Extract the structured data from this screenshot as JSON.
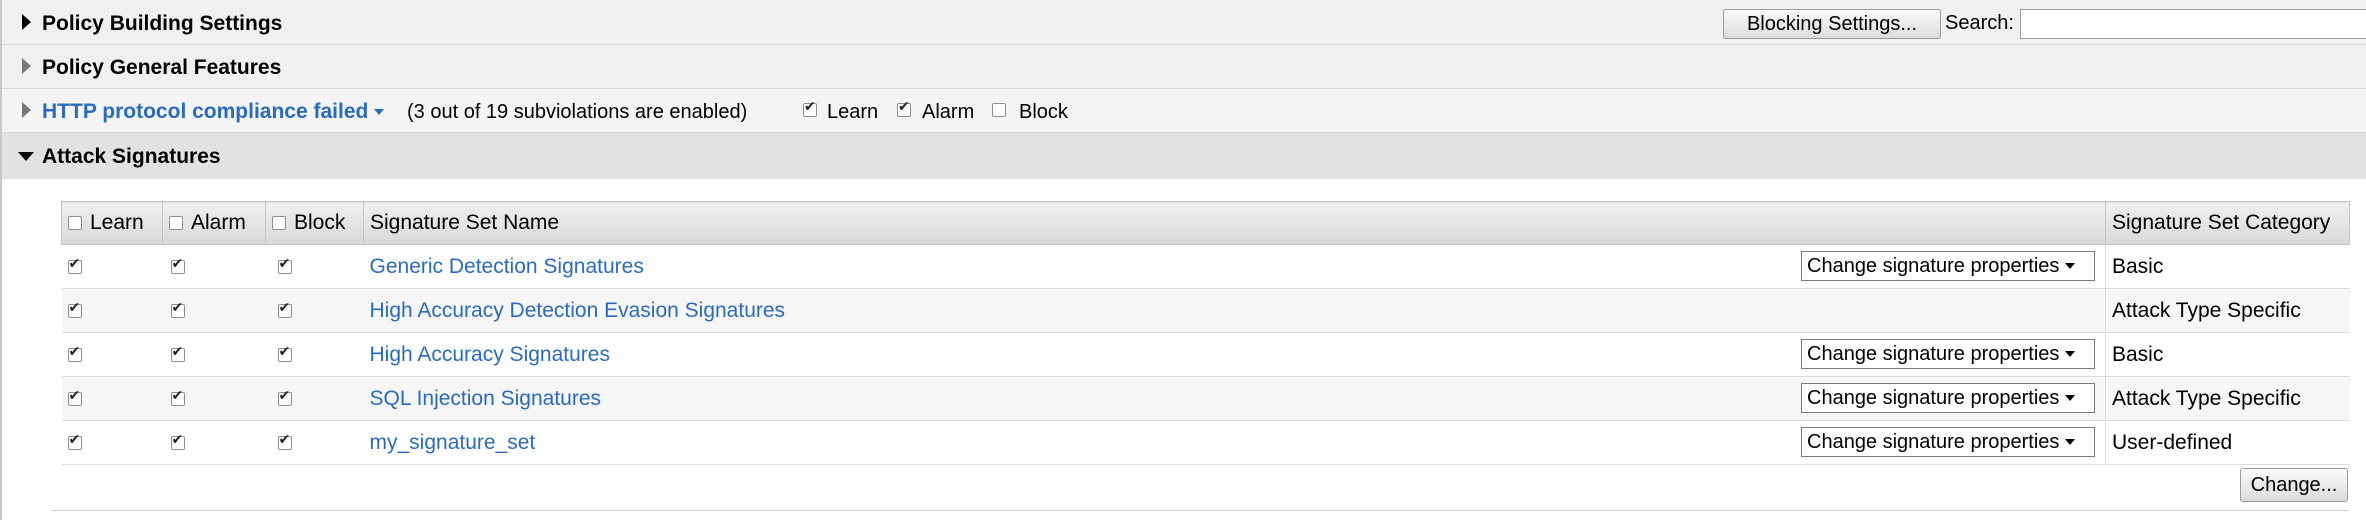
{
  "header": {
    "policy_building_title": "Policy Building Settings",
    "blocking_settings_label": "Blocking Settings...",
    "search_label": "Search:",
    "search_value": "",
    "search_placeholder": ""
  },
  "general_features": {
    "title": "Policy General Features"
  },
  "http_compliance": {
    "link_text": "HTTP protocol compliance failed",
    "summary": "(3 out of 19 subviolations are enabled)",
    "learn_label": "Learn",
    "learn_checked": true,
    "alarm_label": "Alarm",
    "alarm_checked": true,
    "block_label": "Block",
    "block_checked": false
  },
  "attack_signatures": {
    "title": "Attack Signatures",
    "columns": {
      "learn": "Learn",
      "alarm": "Alarm",
      "block": "Block",
      "set_name": "Signature Set Name",
      "category": "Signature Set Category"
    },
    "rows": [
      {
        "name": "Generic Detection Signatures",
        "action": "Change signature properties",
        "category": "Basic",
        "learn": true,
        "alarm": true,
        "block": true
      },
      {
        "name": "High Accuracy Detection Evasion Signatures",
        "action": "",
        "category": "Attack Type Specific",
        "learn": true,
        "alarm": true,
        "block": true
      },
      {
        "name": "High Accuracy Signatures",
        "action": "Change signature properties",
        "category": "Basic",
        "learn": true,
        "alarm": true,
        "block": true
      },
      {
        "name": "SQL Injection Signatures",
        "action": "Change signature properties",
        "category": "Attack Type Specific",
        "learn": true,
        "alarm": true,
        "block": true
      },
      {
        "name": "my_signature_set",
        "action": "Change signature properties",
        "category": "User-defined",
        "learn": true,
        "alarm": true,
        "block": true
      }
    ],
    "change_button_label": "Change..."
  },
  "colors": {
    "link": "#2a6bbf",
    "header_band": "#f0f0f0",
    "expanded_band": "#e2e2e2"
  },
  "icons": {
    "collapsed": "triangle-right-icon",
    "expanded": "triangle-down-icon",
    "dropdown": "caret-down-icon",
    "checkbox": "checkbox-icon"
  }
}
